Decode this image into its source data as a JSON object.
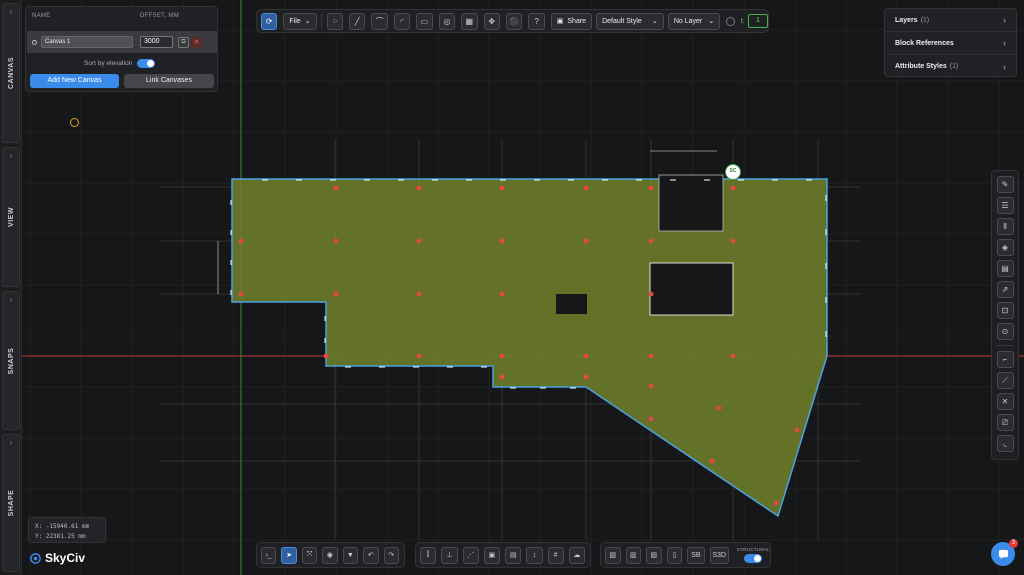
{
  "sidebar": {
    "tabs": [
      {
        "label": "CANVAS"
      },
      {
        "label": "VIEW"
      },
      {
        "label": "SNAPS"
      },
      {
        "label": "SHAPE"
      }
    ]
  },
  "canvas_panel": {
    "col_name": "NAME",
    "col_offset": "OFFSET, MM",
    "canvas_name": "Canvas 1",
    "offset_value": "3000",
    "sort_label": "Sort by elevation",
    "add_button": "Add New Canvas",
    "link_button": "Link Canvases"
  },
  "toolbar": {
    "file_label": "File",
    "share_label": "Share",
    "style_label": "Default Style",
    "layer_label": "No Layer",
    "t_label": "t:",
    "t_value": "1"
  },
  "right_panel": {
    "items": [
      {
        "label": "Layers",
        "count": "(1)"
      },
      {
        "label": "Block References",
        "count": ""
      },
      {
        "label": "Attribute Styles",
        "count": "(1)"
      }
    ]
  },
  "bottom_toolbar": {
    "sb_label": "SB",
    "s3d_label": "S3D",
    "structural_label": "STRUCTURAL"
  },
  "coords": {
    "x": "X: -15940.61 mm",
    "y": "Y: 22381.25 mm"
  },
  "logo": {
    "text": "SkyCiv"
  },
  "marker": {
    "label": "SC"
  },
  "chat": {
    "badge": "3"
  },
  "colors": {
    "accent": "#3b8bea",
    "slab_fill": "#6b7a2a",
    "slab_edge": "#4aa3df",
    "column_dot": "#e84545",
    "axis_red": "#d33a3a",
    "axis_green": "#3a9a3a"
  }
}
